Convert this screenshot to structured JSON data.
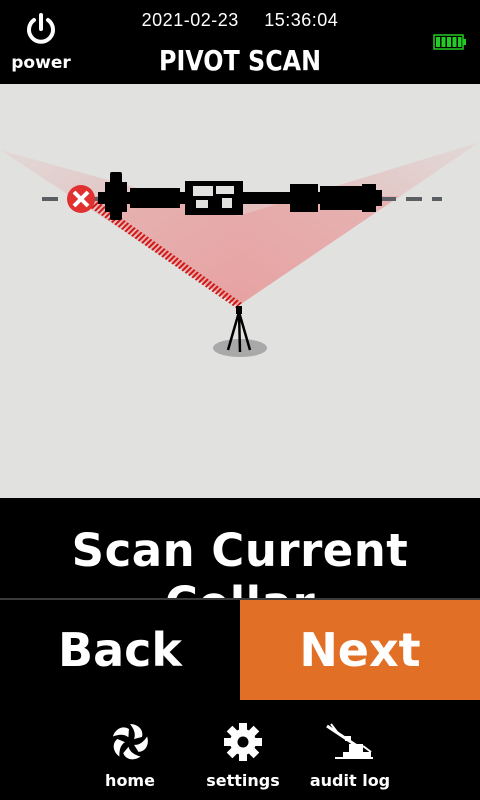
{
  "header": {
    "date": "2021-02-23",
    "time": "15:36:04",
    "title": "PIVOT SCAN",
    "power_label": "power",
    "power_icon": "power-icon",
    "battery_icon": "battery-full-icon",
    "battery_color": "#22cc22"
  },
  "scan": {
    "background_color": "#e1e2e0",
    "beam_color": "#e8a0a0",
    "marker_icon": "error-x-icon",
    "marker_color": "#e03030"
  },
  "instruction": "Scan Current Collar",
  "buttons": {
    "back_label": "Back",
    "next_label": "Next",
    "next_color": "#e26f26"
  },
  "nav": [
    {
      "label": "home",
      "icon": "home-icon"
    },
    {
      "label": "settings",
      "icon": "gear-icon"
    },
    {
      "label": "audit log",
      "icon": "drill-rig-icon"
    }
  ]
}
